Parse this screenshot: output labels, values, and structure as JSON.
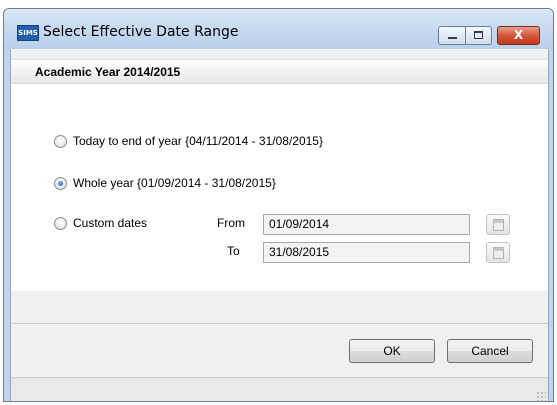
{
  "window": {
    "title": "Select Effective Date Range",
    "app_icon_text": "SIMS",
    "controls": {
      "close_label": "X"
    }
  },
  "group": {
    "title": "Academic Year 2014/2015"
  },
  "options": [
    {
      "label": "Today to end of year {04/11/2014 - 31/08/2015}",
      "checked": false
    },
    {
      "label": "Whole year {01/09/2014 - 31/08/2015}",
      "checked": true
    },
    {
      "label": "Custom dates",
      "checked": false
    }
  ],
  "custom_dates": {
    "from_label": "From",
    "from_value": "01/09/2014",
    "to_label": "To",
    "to_value": "31/08/2015"
  },
  "buttons": {
    "ok": "OK",
    "cancel": "Cancel"
  },
  "colors": {
    "titlebar": "#c3d7f0",
    "close_button": "#c23a1d",
    "radio_selected": "#1a4fa8"
  }
}
